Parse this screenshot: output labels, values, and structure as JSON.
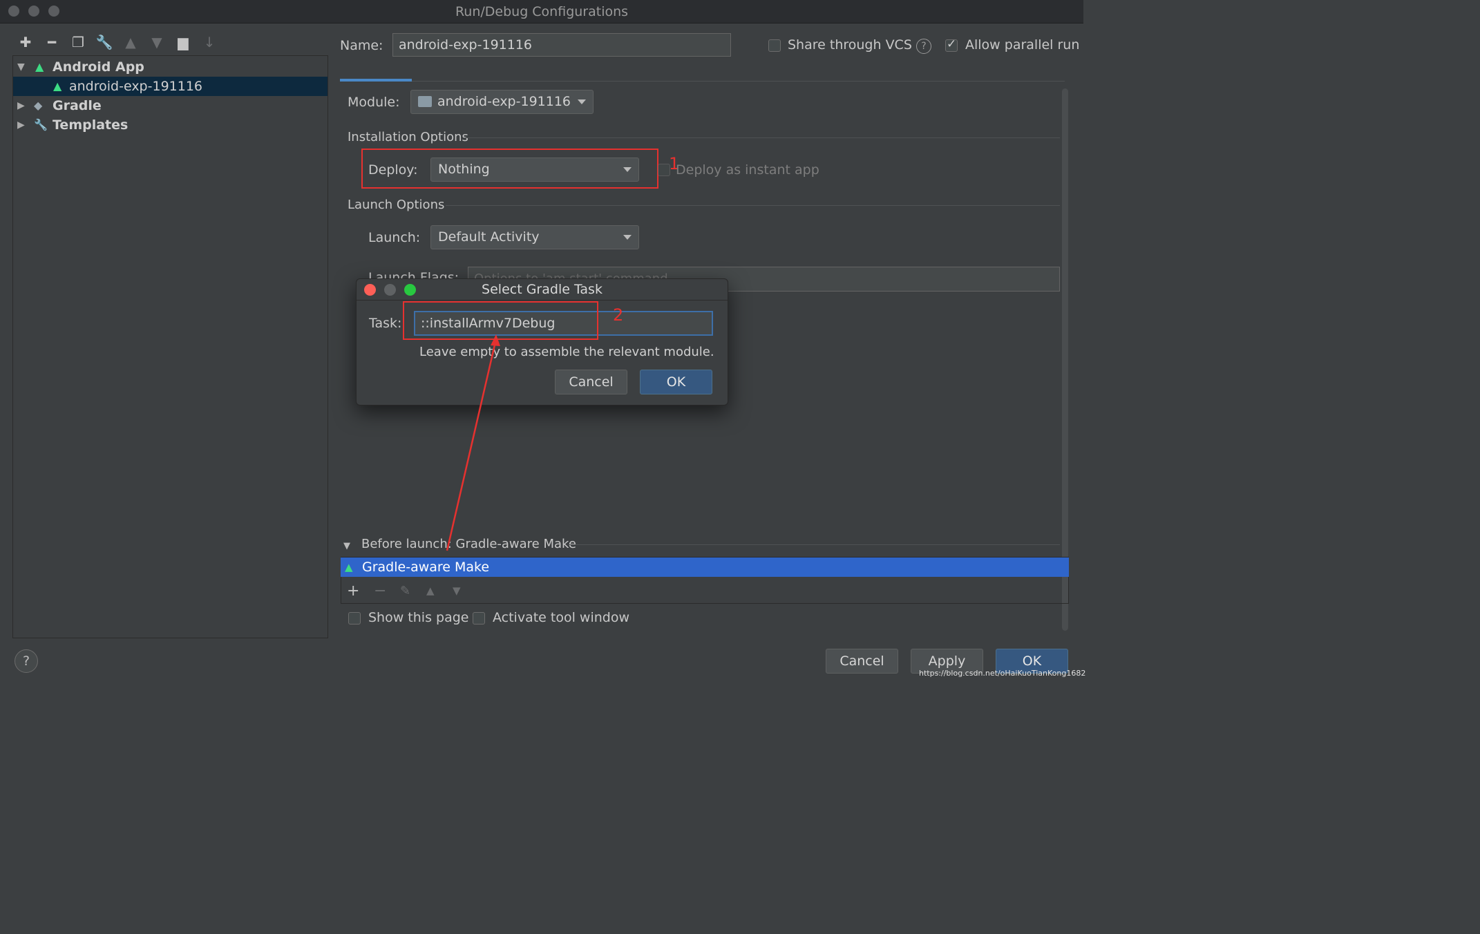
{
  "window": {
    "title": "Run/Debug Configurations"
  },
  "toolbar": {
    "icons": [
      "add-icon",
      "remove-icon",
      "copy-icon",
      "wrench-icon",
      "move-up-icon",
      "move-down-icon",
      "folder-add-icon",
      "sort-icon"
    ]
  },
  "tree": {
    "android_app": "Android App",
    "config": "android-exp-191116",
    "gradle": "Gradle",
    "templates": "Templates"
  },
  "form": {
    "name_label": "Name:",
    "name_value": "android-exp-191116",
    "share_vcs": "Share through VCS",
    "share_vcs_checked": false,
    "allow_parallel": "Allow parallel run",
    "allow_parallel_checked": true,
    "module_label": "Module:",
    "module_value": "android-exp-191116",
    "installation_options": "Installation Options",
    "deploy_label": "Deploy:",
    "deploy_value": "Nothing",
    "deploy_instant": "Deploy as instant app",
    "launch_options": "Launch Options",
    "launch_label": "Launch:",
    "launch_value": "Default Activity",
    "launch_flags_label": "Launch Flags:",
    "launch_flags_placeholder": "Options to 'am start' command"
  },
  "annotations": {
    "one": "1",
    "two": "2"
  },
  "dialog": {
    "title": "Select Gradle Task",
    "task_label": "Task:",
    "task_value": "::installArmv7Debug",
    "hint": "Leave empty to assemble the relevant module.",
    "cancel": "Cancel",
    "ok": "OK"
  },
  "before_launch": {
    "header": "Before launch: Gradle-aware Make",
    "item": "Gradle-aware Make",
    "show_page": "Show this page",
    "activate_tool": "Activate tool window"
  },
  "footer": {
    "help": "?",
    "cancel": "Cancel",
    "apply": "Apply",
    "ok": "OK",
    "watermark": "https://blog.csdn.net/oHaiKuoTianKong1682"
  }
}
